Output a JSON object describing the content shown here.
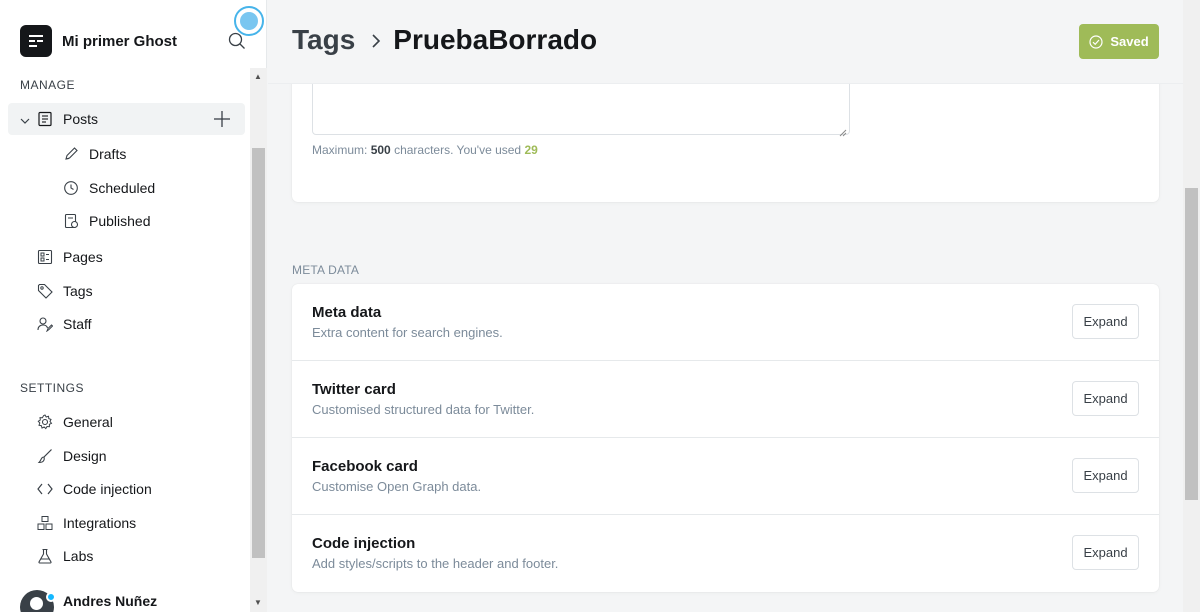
{
  "brand": {
    "name": "Mi primer Ghost"
  },
  "sidebar": {
    "manage_title": "MANAGE",
    "settings_title": "SETTINGS",
    "posts": {
      "label": "Posts"
    },
    "posts_sub": [
      {
        "label": "Drafts",
        "icon": "pencil-icon"
      },
      {
        "label": "Scheduled",
        "icon": "clock-icon"
      },
      {
        "label": "Published",
        "icon": "published-icon"
      }
    ],
    "manage_items": [
      {
        "label": "Pages",
        "icon": "pages-icon"
      },
      {
        "label": "Tags",
        "icon": "tag-icon"
      },
      {
        "label": "Staff",
        "icon": "staff-icon"
      }
    ],
    "settings_items": [
      {
        "label": "General",
        "icon": "gear-icon"
      },
      {
        "label": "Design",
        "icon": "brush-icon"
      },
      {
        "label": "Code injection",
        "icon": "code-icon"
      },
      {
        "label": "Integrations",
        "icon": "integrations-icon"
      },
      {
        "label": "Labs",
        "icon": "flask-icon"
      }
    ],
    "user": {
      "name": "Andres Nuñez"
    }
  },
  "header": {
    "crumb_root": "Tags",
    "crumb_current": "PruebaBorrado",
    "saved_label": "Saved"
  },
  "description": {
    "max_prefix": "Maximum:",
    "max_value": "500",
    "max_mid": "characters. You've used",
    "used_value": "29"
  },
  "meta_section": {
    "title": "META DATA",
    "rows": [
      {
        "title": "Meta data",
        "desc": "Extra content for search engines.",
        "button": "Expand"
      },
      {
        "title": "Twitter card",
        "desc": "Customised structured data for Twitter.",
        "button": "Expand"
      },
      {
        "title": "Facebook card",
        "desc": "Customise Open Graph data.",
        "button": "Expand"
      },
      {
        "title": "Code injection",
        "desc": "Add styles/scripts to the header and footer.",
        "button": "Expand"
      }
    ]
  },
  "colors": {
    "accent_green": "#9fbb58",
    "text_dark": "#15171a",
    "muted": "#7c8b9a"
  }
}
